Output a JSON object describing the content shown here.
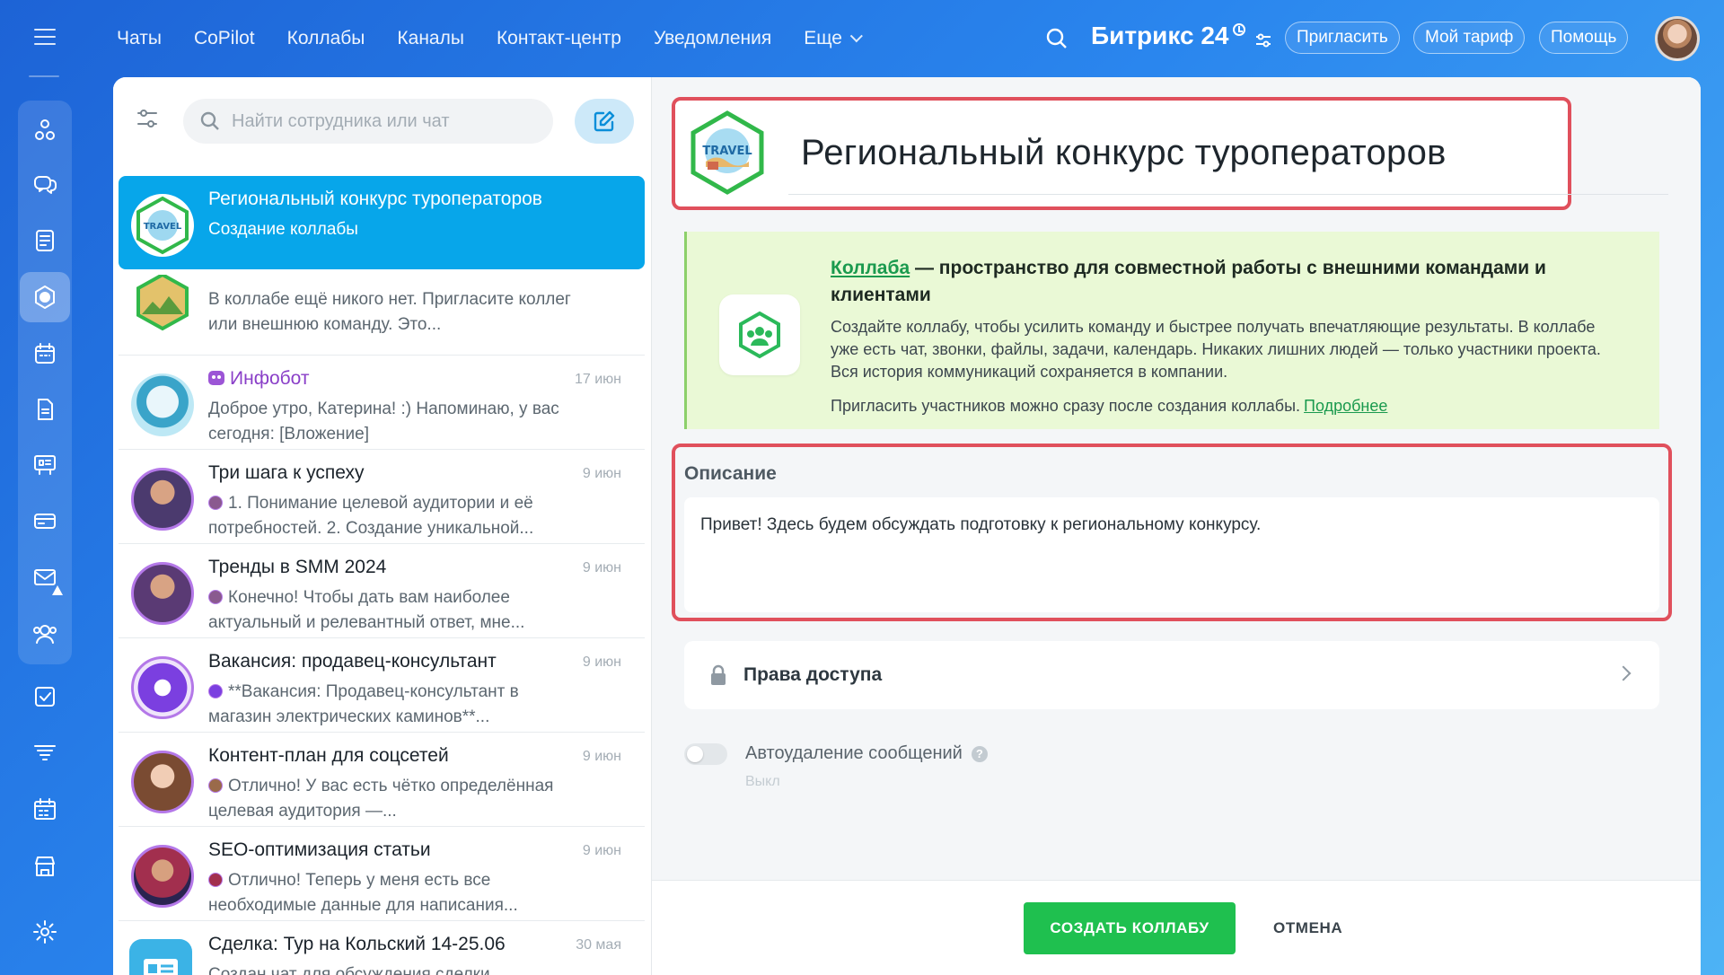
{
  "topnav": {
    "items": [
      "Чаты",
      "CoPilot",
      "Коллабы",
      "Каналы",
      "Контакт-центр",
      "Уведомления",
      "Еще"
    ],
    "brand": "Битрикс 24",
    "invite": "Пригласить",
    "tariff": "Мой тариф",
    "help": "Помощь"
  },
  "search": {
    "placeholder": "Найти сотрудника или чат"
  },
  "chats": [
    {
      "title": "Региональный конкурс туроператоров",
      "date": "",
      "preview": "Создание коллабы"
    },
    {
      "title": "",
      "date": "",
      "preview": "В коллабе ещё никого нет. Пригласите коллег или внешнюю команду. Это..."
    },
    {
      "title": "Инфобот",
      "date": "17 июн",
      "preview": "Доброе утро, Катерина! :) Напоминаю, у вас сегодня: [Вложение]"
    },
    {
      "title": "Три шага к успеху",
      "date": "9 июн",
      "preview": "1. Понимание целевой аудитории и её потребностей. 2. Создание уникальной..."
    },
    {
      "title": "Тренды в SMM 2024",
      "date": "9 июн",
      "preview": "Конечно! Чтобы дать вам наиболее актуальный и релевантный ответ, мне..."
    },
    {
      "title": "Вакансия: продавец-консультант",
      "date": "9 июн",
      "preview": "**Вакансия: Продавец-консультант в магазин электрических каминов**..."
    },
    {
      "title": "Контент-план для соцсетей",
      "date": "9 июн",
      "preview": "Отлично! У вас есть чётко определённая целевая аудитория —..."
    },
    {
      "title": "SEO-оптимизация статьи",
      "date": "9 июн",
      "preview": "Отлично! Теперь у меня есть все необходимые данные для написания..."
    },
    {
      "title": "Сделка: Тур на Кольский 14-25.06",
      "date": "30 мая",
      "preview": "Создан чат для обсуждения сделки"
    }
  ],
  "form": {
    "title": "Региональный конкурс туроператоров",
    "logo_text": "TRAVEL",
    "info": {
      "link": "Коллаба",
      "head_rest": " — пространство для совместной работы с внешними командами и клиентами",
      "body": "Создайте коллабу, чтобы усилить команду и быстрее получать впечатляющие результаты. В коллабе уже есть чат, звонки, файлы, задачи, календарь. Никаких лишних людей — только участники проекта. Вся история коммуникаций сохраняется в компании.",
      "foot": "Пригласить участников можно сразу после создания коллабы.",
      "more": "Подробнее"
    },
    "description_label": "Описание",
    "description_value": "Привет! Здесь будем обсуждать подготовку к региональному конкурсу.",
    "access_label": "Права доступа",
    "autodelete_label": "Автоудаление сообщений",
    "autodelete_value": "Выкл",
    "create_button": "СОЗДАТЬ КОЛЛАБУ",
    "cancel_button": "ОТМЕНА"
  },
  "colors": {
    "accent": "#07a6ea",
    "create": "#1fc04f",
    "highlight": "#e0505c",
    "info_bg": "#eaf9d6"
  }
}
